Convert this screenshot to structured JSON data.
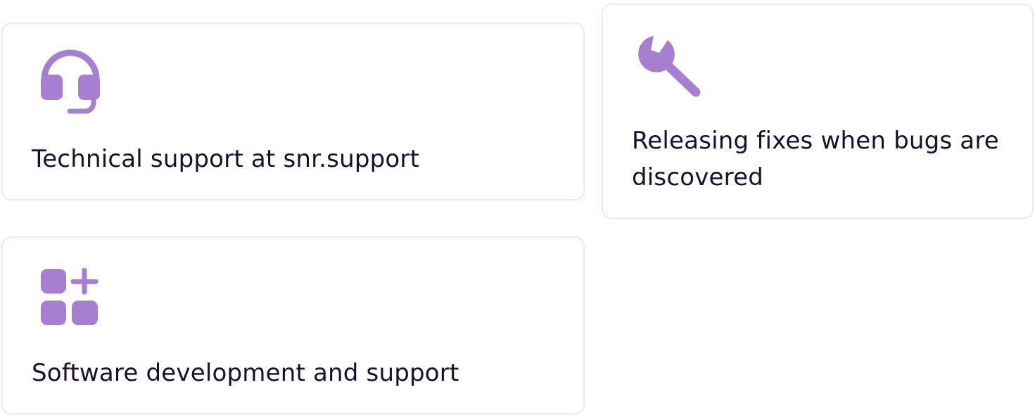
{
  "colors": {
    "accent": "#a77fd0",
    "card_border": "#efe6f8",
    "text": "#1c0f2e",
    "background": "#ffffff"
  },
  "cards": [
    {
      "icon": "headset-icon",
      "text": "Technical support at snr.support"
    },
    {
      "icon": "wrench-icon",
      "text": "Releasing fixes when bugs are discovered"
    },
    {
      "icon": "apps-add-icon",
      "text": "Software development and support"
    }
  ]
}
